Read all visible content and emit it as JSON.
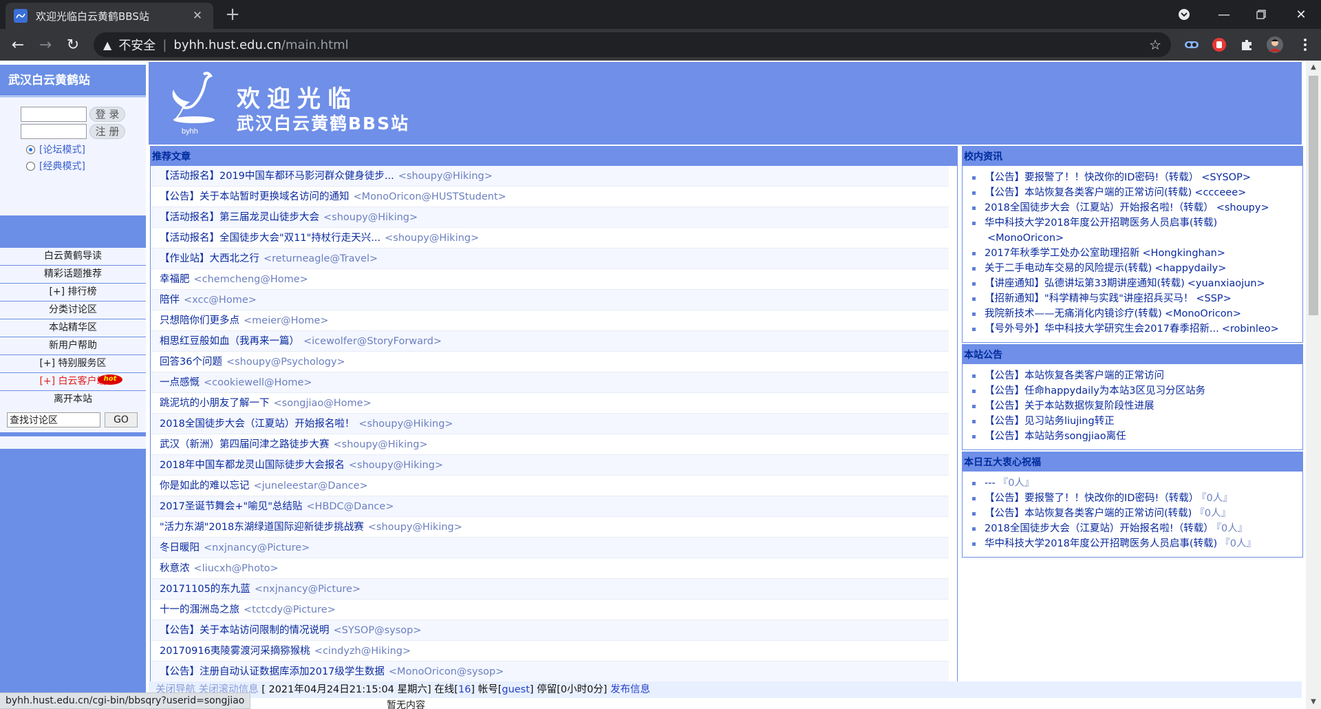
{
  "browser": {
    "tab_title": "欢迎光临白云黄鹤BBS站",
    "insecure_label": "不安全",
    "url_host": "byhh.hust.edu.cn",
    "url_path": "/main.html"
  },
  "sidebar": {
    "site_title": "武汉白云黄鹤站",
    "login_label": "登 录",
    "register_label": "注 册",
    "modes": [
      "[论坛模式]",
      "[经典模式]"
    ],
    "menu": [
      "白云黄鹤导读",
      "精彩话题推荐",
      "[+] 排行榜",
      "分类讨论区",
      "本站精华区",
      "新用户帮助",
      "[+] 特别服务区",
      "[+] 白云客户端",
      "离开本站"
    ],
    "hot_badge": "hot",
    "search_value": "查找讨论区",
    "go_label": "GO"
  },
  "banner": {
    "logo_text": "byhh",
    "welcome": "欢迎光临",
    "site_name": "武汉白云黄鹤BBS站"
  },
  "main": {
    "header": "推荐文章",
    "articles": [
      {
        "title": "【活动报名】2019中国车都环马影河群众健身徒步...",
        "author": "<shoupy@Hiking>"
      },
      {
        "title": "【公告】关于本站暂时更换域名访问的通知",
        "author": "<MonoOricon@HUSTStudent>"
      },
      {
        "title": "【活动报名】第三届龙灵山徒步大会",
        "author": "<shoupy@Hiking>"
      },
      {
        "title": "【活动报名】全国徒步大会\"双11\"持杖行走天兴...",
        "author": "<shoupy@Hiking>"
      },
      {
        "title": "【作业站】大西北之行",
        "author": "<returneagle@Travel>"
      },
      {
        "title": "幸福肥",
        "author": "<chemcheng@Home>"
      },
      {
        "title": "陪伴",
        "author": "<xcc@Home>"
      },
      {
        "title": "只想陪你们更多点",
        "author": "<meier@Home>"
      },
      {
        "title": "相思红豆般如血（我再来一篇）",
        "author": "<icewolfer@StoryForward>"
      },
      {
        "title": "回答36个问题",
        "author": "<shoupy@Psychology>"
      },
      {
        "title": "一点感慨",
        "author": "<cookiewell@Home>"
      },
      {
        "title": "跳泥坑的小朋友了解一下",
        "author": "<songjiao@Home>"
      },
      {
        "title": "2018全国徒步大会（江夏站）开始报名啦！",
        "author": "<shoupy@Hiking>"
      },
      {
        "title": "武汉（新洲）第四届问津之路徒步大赛",
        "author": "<shoupy@Hiking>"
      },
      {
        "title": "2018年中国车都龙灵山国际徒步大会报名",
        "author": "<shoupy@Hiking>"
      },
      {
        "title": "你是如此的难以忘记",
        "author": "<juneleestar@Dance>"
      },
      {
        "title": "2017圣诞节舞会+\"喻见\"总结贴",
        "author": "<HBDC@Dance>"
      },
      {
        "title": "\"活力东湖\"2018东湖绿道国际迎新徒步挑战赛",
        "author": "<shoupy@Hiking>"
      },
      {
        "title": "冬日暖阳",
        "author": "<nxjnancy@Picture>"
      },
      {
        "title": "秋意浓",
        "author": "<liucxh@Photo>"
      },
      {
        "title": "20171105的东九蓝",
        "author": "<nxjnancy@Picture>"
      },
      {
        "title": "十一的涠洲岛之旅",
        "author": "<tctcdy@Picture>"
      },
      {
        "title": "【公告】关于本站访问限制的情况说明",
        "author": "<SYSOP@sysop>"
      },
      {
        "title": "20170916夷陵雾渡河采摘猕猴桃",
        "author": "<cindyzh@Hiking>"
      },
      {
        "title": "【公告】注册自动认证数据库添加2017级学生数据",
        "author": "<MonoOricon@sysop>"
      }
    ]
  },
  "campus_news": {
    "header": "校内资讯",
    "items": [
      {
        "title": "【公告】要报警了！！快改你的ID密码!（转载）",
        "author": "<SYSOP>"
      },
      {
        "title": "【公告】本站恢复各类客户端的正常访问(转载)",
        "author": "<ccceee>"
      },
      {
        "title": "2018全国徒步大会（江夏站）开始报名啦!（转载）",
        "author": "<shoupy>"
      },
      {
        "title": "华中科技大学2018年度公开招聘医务人员启事(转载)",
        "author": "<MonoOricon>"
      },
      {
        "title": "2017年秋季学工处办公室助理招新",
        "author": "<Hongkinghan>"
      },
      {
        "title": "关于二手电动车交易的风险提示(转载)",
        "author": "<happydaily>"
      },
      {
        "title": "【讲座通知】弘德讲坛第33期讲座通知(转载)",
        "author": "<yuanxiaojun>"
      },
      {
        "title": "【招新通知】\"科学精神与实践\"讲座招兵买马！",
        "author": "<SSP>"
      },
      {
        "title": "我院新技术——无痛消化内镜诊疗(转载)",
        "author": "<MonoOricon>"
      },
      {
        "title": "【号外号外】华中科技大学研究生会2017春季招新...",
        "author": "<robinleo>"
      }
    ]
  },
  "announcements": {
    "header": "本站公告",
    "items": [
      "【公告】本站恢复各类客户端的正常访问",
      "【公告】任命happydaily为本站3区见习分区站务",
      "【公告】关于本站数据恢复阶段性进展",
      "【公告】见习站务liujing转正",
      "【公告】本站站务songjiao离任"
    ]
  },
  "top_blessings": {
    "header": "本日五大衷心祝福",
    "items": [
      {
        "title": "---",
        "count": "『0人』"
      },
      {
        "title": "【公告】要报警了！！快改你的ID密码!（转载）",
        "count": "『0人』"
      },
      {
        "title": "【公告】本站恢复各类客户端的正常访问(转载)",
        "count": "『0人』"
      },
      {
        "title": "2018全国徒步大会（江夏站）开始报名啦!（转载）",
        "count": "『0人』"
      },
      {
        "title": "华中科技大学2018年度公开招聘医务人员启事(转载)",
        "count": "『0人』"
      }
    ]
  },
  "bottom_bar": {
    "prefix": "关闭导航 关闭滚动信息",
    "time": "[ 2021年04月24日21:15:04 星期六]",
    "online_label": "在线[",
    "online_count": "16",
    "account_label": "] 帐号[",
    "account": "guest",
    "stay_label": "] 停留[0小时0分]",
    "publish": "发布信息",
    "empty": "暂无内容"
  },
  "status_url": "byhh.hust.edu.cn/cgi-bin/bbsqry?userid=songjiao",
  "colors": {
    "sidebar_blue": "#6b8fe6",
    "link_blue": "#0a2a9e",
    "chrome_dark": "#202124"
  }
}
